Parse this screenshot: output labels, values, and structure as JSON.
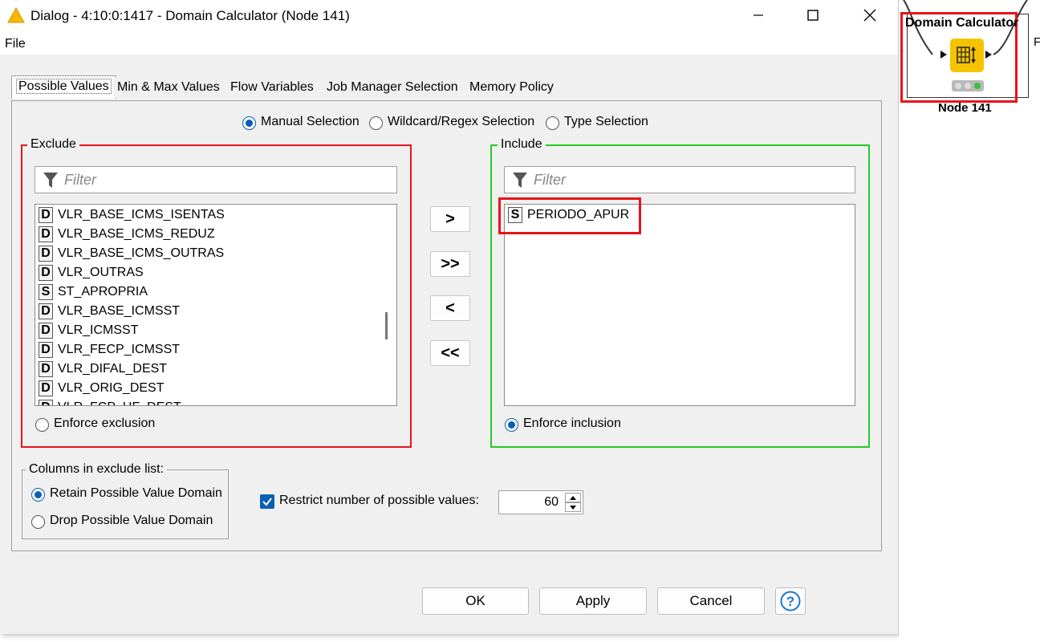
{
  "window": {
    "title": "Dialog - 4:10:0:1417 - Domain Calculator (Node 141)",
    "minimize_icon": "minimize-icon",
    "maximize_icon": "maximize-icon",
    "close_icon": "close-icon"
  },
  "menu": {
    "file": "File"
  },
  "tabs": [
    {
      "label": "Possible Values",
      "active": true
    },
    {
      "label": "Min & Max Values"
    },
    {
      "label": "Flow Variables"
    },
    {
      "label": "Job Manager Selection"
    },
    {
      "label": "Memory Policy"
    }
  ],
  "selection_mode": {
    "options": [
      "Manual Selection",
      "Wildcard/Regex Selection",
      "Type Selection"
    ],
    "selected": "Manual Selection"
  },
  "exclude": {
    "legend": "Exclude",
    "filter_placeholder": "Filter",
    "items": [
      {
        "type": "D",
        "name": "VLR_BASE_ICMS_ISENTAS"
      },
      {
        "type": "D",
        "name": "VLR_BASE_ICMS_REDUZ"
      },
      {
        "type": "D",
        "name": "VLR_BASE_ICMS_OUTRAS"
      },
      {
        "type": "D",
        "name": "VLR_OUTRAS"
      },
      {
        "type": "S",
        "name": "ST_APROPRIA"
      },
      {
        "type": "D",
        "name": "VLR_BASE_ICMSST"
      },
      {
        "type": "D",
        "name": "VLR_ICMSST"
      },
      {
        "type": "D",
        "name": "VLR_FECP_ICMSST"
      },
      {
        "type": "D",
        "name": "VLR_DIFAL_DEST"
      },
      {
        "type": "D",
        "name": "VLR_ORIG_DEST"
      },
      {
        "type": "D",
        "name": "VLR_FCP_UF_DEST"
      }
    ],
    "enforce_label": "Enforce exclusion",
    "enforce_checked": false
  },
  "include": {
    "legend": "Include",
    "filter_placeholder": "Filter",
    "items": [
      {
        "type": "S",
        "name": "PERIODO_APUR"
      }
    ],
    "enforce_label": "Enforce inclusion",
    "enforce_checked": true
  },
  "transfer_buttons": {
    "add": ">",
    "add_all": ">>",
    "remove": "<",
    "remove_all": "<<"
  },
  "exclude_columns": {
    "legend": "Columns in exclude list:",
    "options": [
      "Retain Possible Value Domain",
      "Drop Possible Value Domain"
    ],
    "selected": "Retain Possible Value Domain"
  },
  "restrict": {
    "label": "Restrict number of possible values:",
    "checked": true,
    "value": "60"
  },
  "buttons": {
    "ok": "OK",
    "apply": "Apply",
    "cancel": "Cancel",
    "help_icon": "help-icon"
  },
  "node": {
    "title": "Domain Calculator",
    "label": "Node 141",
    "icon": "domain-calculator-icon",
    "side_text": "F"
  },
  "colors": {
    "accent": "#0a5fb4",
    "exclude_border": "#e8141b",
    "include_border": "#22cc22",
    "node_icon": "#f5c400"
  }
}
